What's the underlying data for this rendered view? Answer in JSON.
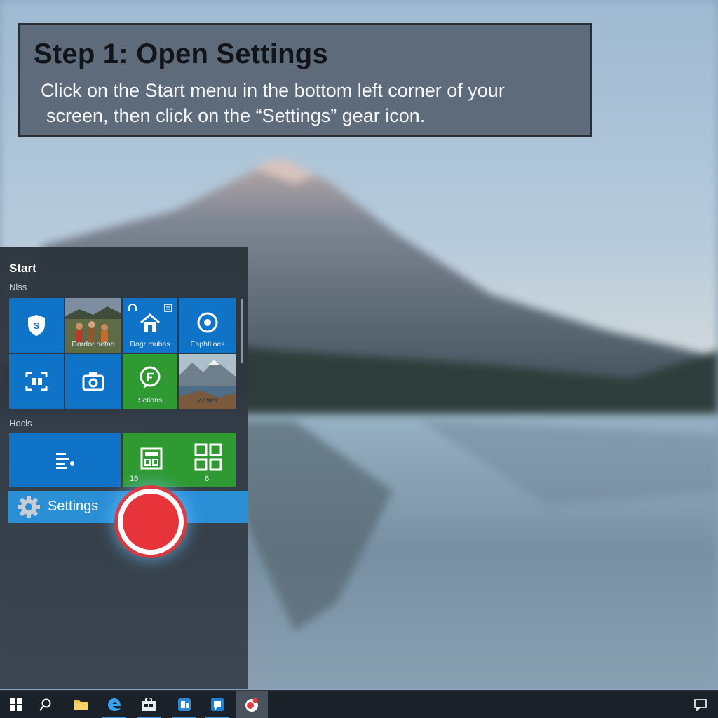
{
  "banner": {
    "title": "Step 1: Open Settings",
    "text_line1": "Click on the Start menu in the bottom left corner of your",
    "text_line2": "screen, then click on the “Settings” gear icon."
  },
  "start_menu": {
    "title": "Start",
    "group1_label": "Nlss",
    "group2_label": "Hocls",
    "tiles": [
      {
        "icon": "shield-icon",
        "label": "",
        "color": "#0f73c8"
      },
      {
        "icon": "photo-people",
        "label": "Dordor rietad",
        "color": "#6b5a3e"
      },
      {
        "icon": "home-icon",
        "label": "Dogr mubas",
        "color": "#0f73c8"
      },
      {
        "icon": "disc-icon",
        "label": "Eaphtiloes",
        "color": "#0f73c8"
      },
      {
        "icon": "scan-icon",
        "label": "",
        "color": "#0f73c8"
      },
      {
        "icon": "camera-icon",
        "label": "",
        "color": "#0f73c8"
      },
      {
        "icon": "chat-icon",
        "label": "Sctions",
        "color": "#2f9a32"
      },
      {
        "icon": "photo-landscape",
        "label": "Zeses",
        "color": "#5d7688"
      },
      {
        "icon": "list-icon",
        "label": "",
        "color": "#0f73c8"
      },
      {
        "icon": "calculator-icon",
        "label": "16",
        "color": "#2f9a32"
      },
      {
        "icon": "apps-grid-icon",
        "label": "6",
        "color": "#2f9a32"
      }
    ],
    "settings_label": "Settings"
  },
  "taskbar": {
    "items": [
      "windows-start-icon",
      "search-icon",
      "file-explorer-icon",
      "edge-icon",
      "store-icon",
      "app-icon",
      "mail-icon",
      "settings-app-icon",
      "notifications-icon"
    ]
  },
  "colors": {
    "tile_blue": "#0f73c8",
    "tile_green": "#2f9a32",
    "settings_highlight": "#2b8fd6",
    "click_marker": "#e7333a",
    "taskbar": "#1b2128"
  }
}
